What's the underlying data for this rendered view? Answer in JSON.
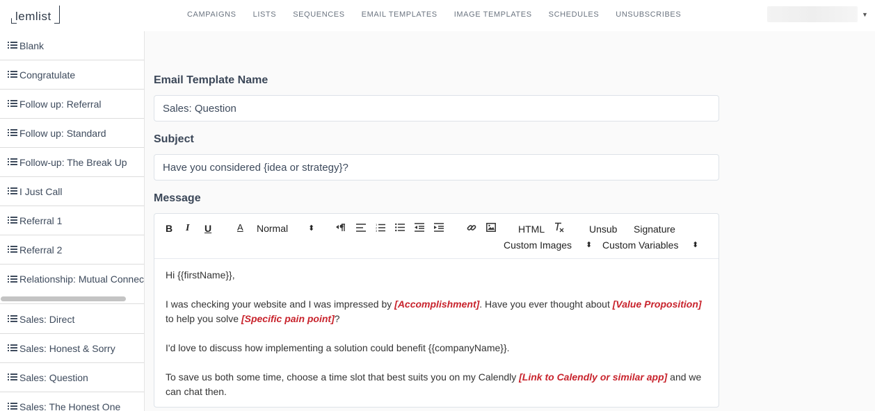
{
  "logo": {
    "text": "lemlist"
  },
  "nav": {
    "items": [
      "CAMPAIGNS",
      "LISTS",
      "SEQUENCES",
      "EMAIL TEMPLATES",
      "IMAGE TEMPLATES",
      "SCHEDULES",
      "UNSUBSCRIBES"
    ]
  },
  "account": {
    "caret": "▼"
  },
  "sidebar": {
    "items": [
      "Blank",
      "Congratulate",
      "Follow up: Referral",
      "Follow up: Standard",
      "Follow-up: The Break Up",
      "I Just Call",
      "Referral 1",
      "Referral 2",
      "Relationship: Mutual Connection",
      "Sales: Direct",
      "Sales: Honest & Sorry",
      "Sales: Question",
      "Sales: The Honest One"
    ]
  },
  "form": {
    "name_label": "Email Template Name",
    "name_value": "Sales: Question",
    "subject_label": "Subject",
    "subject_value": "Have you considered {idea or strategy}?",
    "message_label": "Message"
  },
  "toolbar": {
    "bold": "B",
    "italic": "I",
    "underline": "U",
    "font_color": "A",
    "heading_select": "Normal",
    "select_arrows": "⬍",
    "html": "HTML",
    "unsub": "Unsub",
    "signature": "Signature",
    "custom_images": "Custom Images",
    "custom_variables": "Custom Variables"
  },
  "message": {
    "greeting": "Hi {{firstName}},",
    "p1_a": "I was checking your website and I was impressed by ",
    "p1_h1": "[Accomplishment]",
    "p1_b": ". Have you ever thought about ",
    "p1_h2": "[Value Proposition]",
    "p1_c": " to help you solve ",
    "p1_h3": "[Specific pain point]",
    "p1_d": "?",
    "p2": "I'd love to discuss how implementing a solution could benefit {{companyName}}.",
    "p3_a": "To save us both some time, choose a time slot that best suits you on my Calendly ",
    "p3_h1": "[Link to Calendly or similar app]",
    "p3_b": " and we can chat then."
  },
  "colors": {
    "highlight": "#c8232c",
    "text": "#3d4a5c"
  }
}
